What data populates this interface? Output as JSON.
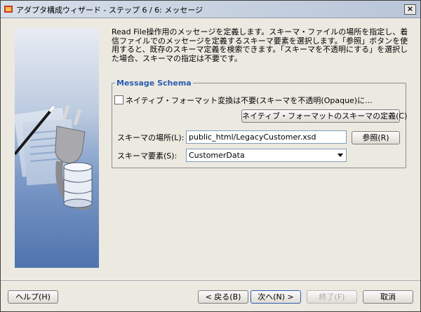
{
  "window": {
    "title": "アダプタ構成ウィザード - ステップ 6 / 6: メッセージ",
    "close_label": "×"
  },
  "description": "Read File操作用のメッセージを定義します。スキーマ・ファイルの場所を指定し、着信ファイルでのメッセージを定義するスキーマ要素を選択します。「参照」ボタンを使用すると、既存のスキーマ定義を検索できます。「スキーマを不透明にする」を選択した場合、スキーマの指定は不要です。",
  "schema": {
    "legend": "Message Schema",
    "native_checkbox_label": "ネイティブ・フォーマット変換は不要(スキーマを不透明(Opaque)に...",
    "define_native_button": "ネイティブ・フォーマットのスキーマの定義(C)",
    "location_label": "スキーマの場所(L):",
    "location_value": "public_html/LegacyCustomer.xsd",
    "browse_button": "参照(R)",
    "element_label": "スキーマ要素(S):",
    "element_value": "CustomerData"
  },
  "footer": {
    "help": "ヘルプ(H)",
    "back": "< 戻る(B)",
    "next": "次へ(N) >",
    "finish": "終了(F)",
    "cancel": "取消"
  }
}
